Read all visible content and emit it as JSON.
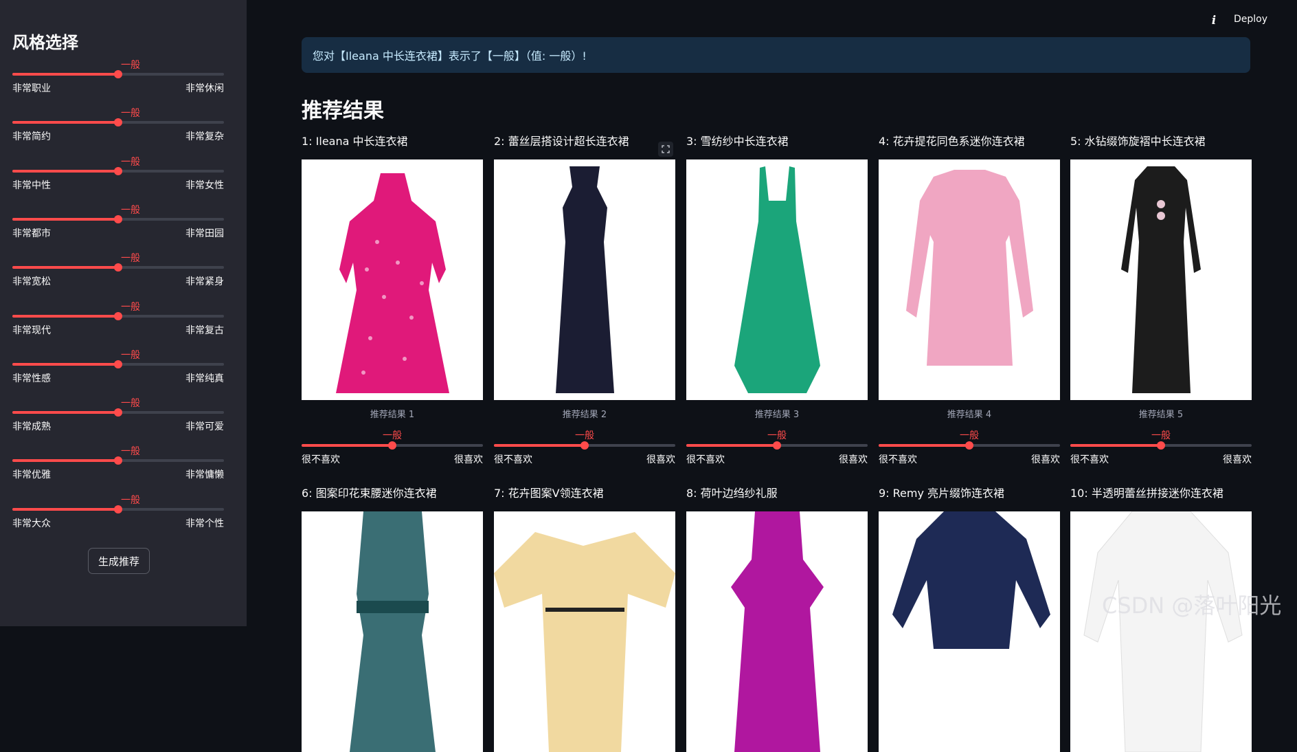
{
  "sidebar": {
    "title": "风格选择",
    "sliders": [
      {
        "value": "一般",
        "left": "非常职业",
        "right": "非常休闲",
        "level": 0.5
      },
      {
        "value": "一般",
        "left": "非常简约",
        "right": "非常复杂",
        "level": 0.5
      },
      {
        "value": "一般",
        "left": "非常中性",
        "right": "非常女性",
        "level": 0.5
      },
      {
        "value": "一般",
        "left": "非常都市",
        "right": "非常田园",
        "level": 0.5
      },
      {
        "value": "一般",
        "left": "非常宽松",
        "right": "非常紧身",
        "level": 0.5
      },
      {
        "value": "一般",
        "left": "非常现代",
        "right": "非常复古",
        "level": 0.5
      },
      {
        "value": "一般",
        "left": "非常性感",
        "right": "非常纯真",
        "level": 0.5
      },
      {
        "value": "一般",
        "left": "非常成熟",
        "right": "非常可爱",
        "level": 0.5
      },
      {
        "value": "一般",
        "left": "非常优雅",
        "right": "非常慵懒",
        "level": 0.5
      },
      {
        "value": "一般",
        "left": "非常大众",
        "right": "非常个性",
        "level": 0.5
      }
    ],
    "generate_button": "生成推荐"
  },
  "header": {
    "deploy_label": "Deploy",
    "info_icon": "i"
  },
  "alert": {
    "text": "您对【Ileana 中长连衣裙】表示了【一般】（值: 一般）!"
  },
  "main": {
    "title": "推荐结果",
    "items": [
      {
        "name": "1: Ileana 中长连衣裙",
        "caption": "推荐结果 1",
        "value": "一般",
        "left": "很不喜欢",
        "right": "很喜欢",
        "level": 0.5,
        "color": "#e0197a"
      },
      {
        "name": "2: 蕾丝层搭设计超长连衣裙",
        "caption": "推荐结果 2",
        "value": "一般",
        "left": "很不喜欢",
        "right": "很喜欢",
        "level": 0.5,
        "color": "#1b1d33"
      },
      {
        "name": "3: 雪纺纱中长连衣裙",
        "caption": "推荐结果 3",
        "value": "一般",
        "left": "很不喜欢",
        "right": "很喜欢",
        "level": 0.5,
        "color": "#1ba57a"
      },
      {
        "name": "4: 花卉提花同色系迷你连衣裙",
        "caption": "推荐结果 4",
        "value": "一般",
        "left": "很不喜欢",
        "right": "很喜欢",
        "level": 0.5,
        "color": "#f0a6c2"
      },
      {
        "name": "5: 水钻缀饰旋褶中长连衣裙",
        "caption": "推荐结果 5",
        "value": "一般",
        "left": "很不喜欢",
        "right": "很喜欢",
        "level": 0.5,
        "color": "#1c1c1c"
      },
      {
        "name": "6: 图案印花束腰迷你连衣裙",
        "color": "#3a6e74"
      },
      {
        "name": "7: 花卉图案V领连衣裙",
        "color": "#f1d9a0"
      },
      {
        "name": "8: 荷叶边绉纱礼服",
        "color": "#b0179f"
      },
      {
        "name": "9: Remy 亮片缀饰连衣裙",
        "color": "#1e2a55"
      },
      {
        "name": "10: 半透明蕾丝拼接迷你连衣裙",
        "color": "#f4f4f4"
      }
    ]
  },
  "watermark": "CSDN @落叶阳光",
  "colors": {
    "accent": "#ff4b4b",
    "sidebar_bg": "#262730",
    "main_bg": "#0e1117",
    "alert_bg": "#172d43"
  }
}
